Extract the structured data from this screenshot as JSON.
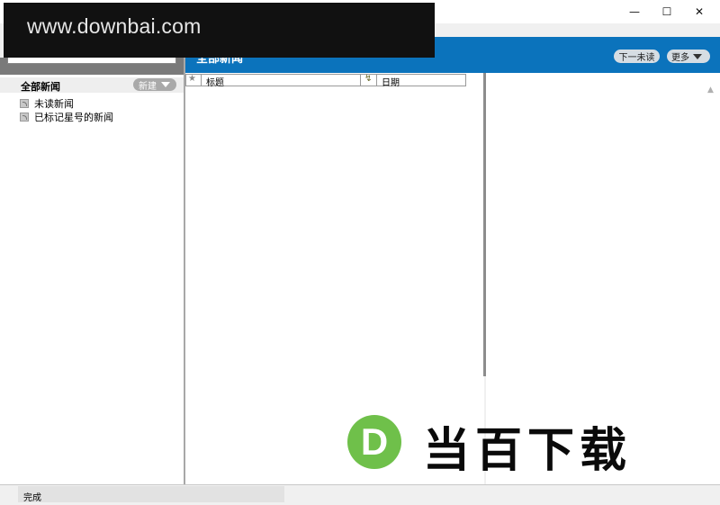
{
  "watermark": {
    "text": "www.downbai.com"
  },
  "window": {
    "minimize_glyph": "—",
    "maximize_glyph": "☐",
    "close_glyph": "✕"
  },
  "header": {
    "title": "全部新闻",
    "next_unread_label": "下一未读",
    "more_label": "更多"
  },
  "sidebar": {
    "all_news_label": "全部新闻",
    "new_button_label": "新建",
    "items": [
      {
        "label": "未读新闻",
        "icon": "feed-icon"
      },
      {
        "label": "已标记星号的新闻",
        "icon": "feed-icon"
      }
    ]
  },
  "list": {
    "star_col_glyph": "★",
    "columns": {
      "title": "标题",
      "date": "日期"
    }
  },
  "logo": {
    "mark": "D",
    "text": "当百下载",
    "color": "#6fc04a"
  },
  "status": {
    "text": "完成"
  },
  "colors": {
    "header_blue": "#0b73bc"
  }
}
